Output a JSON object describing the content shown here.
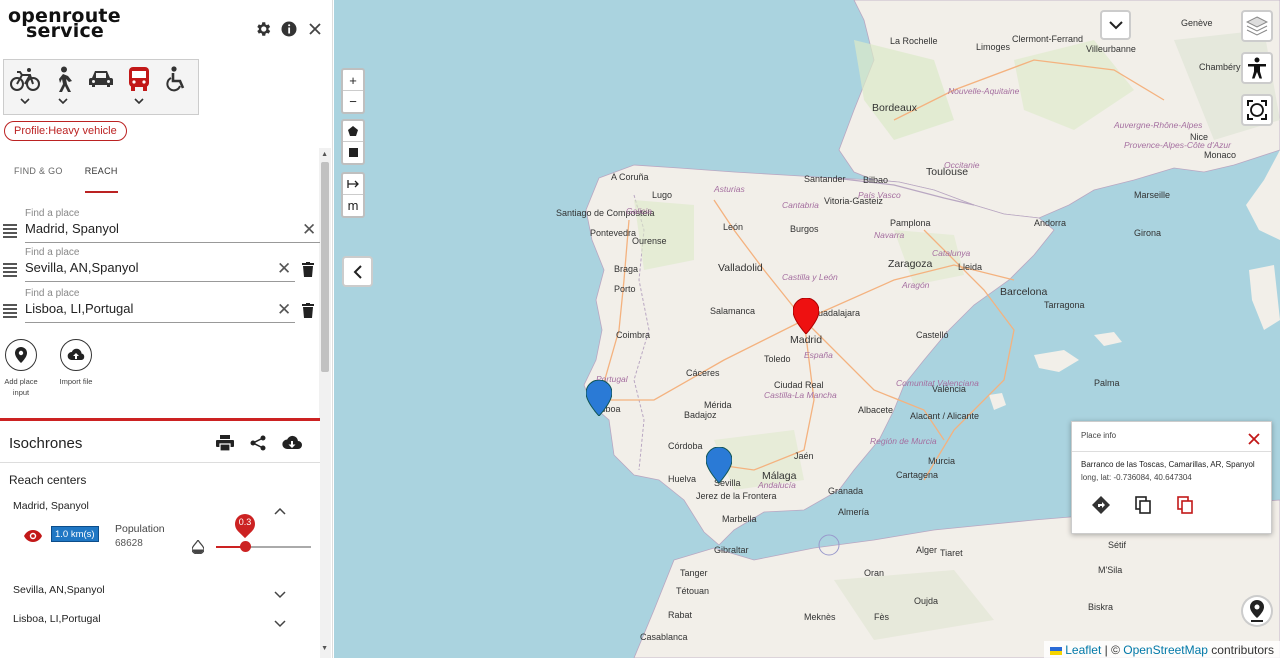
{
  "app": {
    "logo_line1": "openroute",
    "logo_line2": "service"
  },
  "profile_badge": "Profile:Heavy vehicle",
  "tabs": [
    "FIND & GO",
    "REACH"
  ],
  "places": [
    {
      "label": "Find a place",
      "value": "Madrid, Spanyol"
    },
    {
      "label": "Find a place",
      "value": "Sevilla, AN,Spanyol"
    },
    {
      "label": "Find a place",
      "value": "Lisboa, LI,Portugal"
    }
  ],
  "actions": {
    "add_place_line1": "Add place",
    "add_place_line2": "input",
    "import_file": "Import file"
  },
  "isochrones": {
    "title": "Isochrones",
    "reach_centers_title": "Reach centers",
    "centers": [
      "Madrid, Spanyol",
      "Sevilla, AN,Spanyol",
      "Lisboa, LI,Portugal"
    ],
    "range_badge": "1.0 km(s)",
    "population_label": "Population",
    "population_value": "68628",
    "opacity_value": "0.3",
    "opacity_fraction": 0.3
  },
  "map": {
    "zoom_in": "+",
    "zoom_out": "−",
    "measure_label": "m",
    "cities": [
      {
        "t": "La Rochelle",
        "k": "city"
      },
      {
        "t": "Limoges",
        "k": "city"
      },
      {
        "t": "Clermont-Ferrand",
        "k": "city"
      },
      {
        "t": "Villeurbanne",
        "k": "city"
      },
      {
        "t": "Genève",
        "k": "city"
      },
      {
        "t": "Chambéry",
        "k": "city"
      },
      {
        "t": "Bordeaux",
        "k": "big"
      },
      {
        "t": "Nouvelle-Aquitaine",
        "k": "region"
      },
      {
        "t": "Auvergne-Rhône-Alpes",
        "k": "region"
      },
      {
        "t": "Toulouse",
        "k": "big"
      },
      {
        "t": "Occitanie",
        "k": "region"
      },
      {
        "t": "Nice",
        "k": "city"
      },
      {
        "t": "Monaco",
        "k": "city"
      },
      {
        "t": "Provence-Alpes-Côte d'Azur",
        "k": "region"
      },
      {
        "t": "Marseille",
        "k": "city"
      },
      {
        "t": "A Coruña",
        "k": "city"
      },
      {
        "t": "Santander",
        "k": "city"
      },
      {
        "t": "Bilbao",
        "k": "city"
      },
      {
        "t": "Santiago de Compostela",
        "k": "city"
      },
      {
        "t": "Lugo",
        "k": "city"
      },
      {
        "t": "Asturias",
        "k": "region"
      },
      {
        "t": "Cantabria",
        "k": "region"
      },
      {
        "t": "País Vasco",
        "k": "region"
      },
      {
        "t": "Vitoria-Gasteiz",
        "k": "city"
      },
      {
        "t": "Galicia",
        "k": "region"
      },
      {
        "t": "Pamplona",
        "k": "city"
      },
      {
        "t": "Andorra",
        "k": "city"
      },
      {
        "t": "Pontevedra",
        "k": "city"
      },
      {
        "t": "León",
        "k": "city"
      },
      {
        "t": "Burgos",
        "k": "city"
      },
      {
        "t": "Navarra",
        "k": "region"
      },
      {
        "t": "Ourense",
        "k": "city"
      },
      {
        "t": "Girona",
        "k": "city"
      },
      {
        "t": "Zaragoza",
        "k": "big"
      },
      {
        "t": "Catalunya",
        "k": "region"
      },
      {
        "t": "Braga",
        "k": "city"
      },
      {
        "t": "Valladolid",
        "k": "big"
      },
      {
        "t": "Castilla y León",
        "k": "region"
      },
      {
        "t": "Lleida",
        "k": "city"
      },
      {
        "t": "Porto",
        "k": "city"
      },
      {
        "t": "Aragón",
        "k": "region"
      },
      {
        "t": "Barcelona",
        "k": "big"
      },
      {
        "t": "Salamanca",
        "k": "city"
      },
      {
        "t": "Guadalajara",
        "k": "city"
      },
      {
        "t": "Tarragona",
        "k": "city"
      },
      {
        "t": "Coimbra",
        "k": "city"
      },
      {
        "t": "Madrid",
        "k": "big"
      },
      {
        "t": "Castelló",
        "k": "city"
      },
      {
        "t": "España",
        "k": "region"
      },
      {
        "t": "Toledo",
        "k": "city"
      },
      {
        "t": "Palma",
        "k": "city"
      },
      {
        "t": "Portugal",
        "k": "region"
      },
      {
        "t": "Cáceres",
        "k": "city"
      },
      {
        "t": "Ciudad Real",
        "k": "city"
      },
      {
        "t": "Comunitat Valenciana",
        "k": "region"
      },
      {
        "t": "València",
        "k": "city"
      },
      {
        "t": "Lisboa",
        "k": "city"
      },
      {
        "t": "Mérida",
        "k": "city"
      },
      {
        "t": "Castilla-La Mancha",
        "k": "region"
      },
      {
        "t": "Badajoz",
        "k": "city"
      },
      {
        "t": "Albacete",
        "k": "city"
      },
      {
        "t": "Alacant / Alicante",
        "k": "city"
      },
      {
        "t": "Córdoba",
        "k": "city"
      },
      {
        "t": "Región de Murcia",
        "k": "region"
      },
      {
        "t": "Jaén",
        "k": "city"
      },
      {
        "t": "Murcia",
        "k": "city"
      },
      {
        "t": "Huelva",
        "k": "city"
      },
      {
        "t": "Sevilla",
        "k": "city"
      },
      {
        "t": "Andalucía",
        "k": "region"
      },
      {
        "t": "Granada",
        "k": "city"
      },
      {
        "t": "Cartagena",
        "k": "city"
      },
      {
        "t": "Jerez de la Frontera",
        "k": "city"
      },
      {
        "t": "Málaga",
        "k": "big"
      },
      {
        "t": "Almería",
        "k": "city"
      },
      {
        "t": "Marbella",
        "k": "city"
      },
      {
        "t": "Gibraltar",
        "k": "city"
      },
      {
        "t": "Tanger",
        "k": "city"
      },
      {
        "t": "Tétouan",
        "k": "city"
      },
      {
        "t": "Oran",
        "k": "city"
      },
      {
        "t": "Tiaret",
        "k": "city"
      },
      {
        "t": "Sétif",
        "k": "city"
      },
      {
        "t": "Alger",
        "k": "city"
      },
      {
        "t": "M'Sila",
        "k": "city"
      },
      {
        "t": "Biskra",
        "k": "city"
      },
      {
        "t": "Rabat",
        "k": "city"
      },
      {
        "t": "Oujda",
        "k": "city"
      },
      {
        "t": "Meknès",
        "k": "city"
      },
      {
        "t": "Fès",
        "k": "city"
      },
      {
        "t": "Casablanca",
        "k": "city"
      }
    ]
  },
  "place_info": {
    "title": "Place info",
    "name": "Barranco de las Toscas, Camarillas, AR, Spanyol",
    "coords": "long, lat: -0.736084, 40.647304"
  },
  "attribution": {
    "leaflet": "Leaflet",
    "separator": " | © ",
    "osm": "OpenStreetMap",
    "suffix": " contributors"
  },
  "colors": {
    "brand": "#b22222",
    "sea": "#aad3df",
    "land": "#f2efe9",
    "marker_red": "#ee1111",
    "marker_blue": "#2a7ad6"
  }
}
